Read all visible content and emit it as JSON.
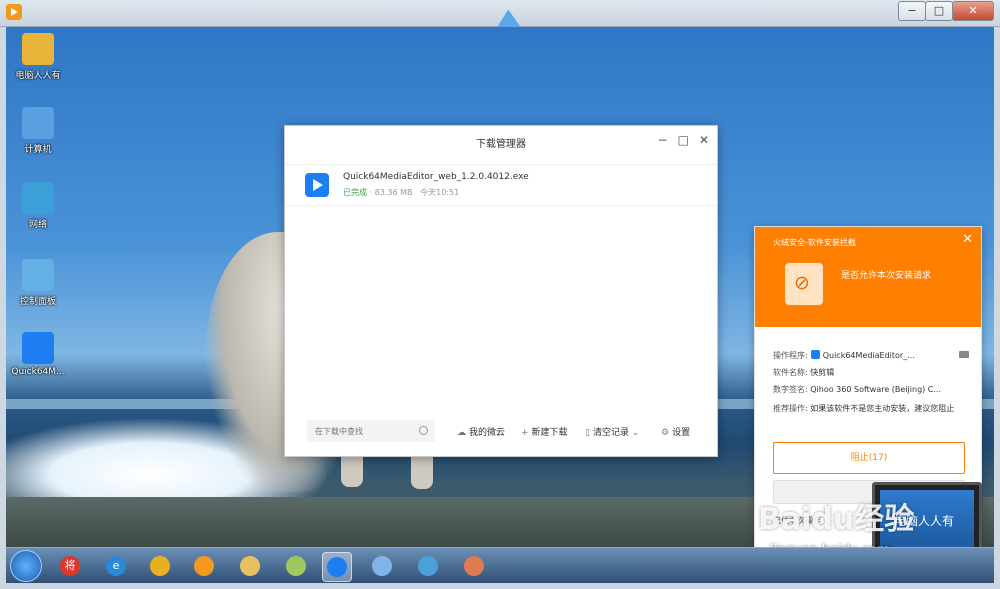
{
  "desktop_icons": [
    {
      "label": "电脑人人有",
      "icon": "folder-user-icon",
      "color": "#e8b53a"
    },
    {
      "label": "计算机",
      "icon": "computer-icon",
      "color": "#5aa0e0"
    },
    {
      "label": "网络",
      "icon": "network-icon",
      "color": "#3d9fd8"
    },
    {
      "label": "控制面板",
      "icon": "control-panel-icon",
      "color": "#63b0e6"
    },
    {
      "label": "Quick64M...",
      "icon": "quick-editor-icon",
      "color": "#1c7ef1"
    }
  ],
  "download_manager": {
    "title": "下载管理器",
    "controls": {
      "minimize": "−",
      "maximize": "□",
      "close": "✕"
    },
    "items": [
      {
        "filename": "Quick64MediaEditor_web_1.2.0.4012.exe",
        "status": "已完成",
        "size": "83.36 MB",
        "time": "今天10:51"
      }
    ],
    "footer": {
      "search_placeholder": "在下载中查找",
      "cloud": "我的微云",
      "new_download": "新建下载",
      "clear": "清空记录",
      "settings": "设置"
    }
  },
  "security_popup": {
    "title": "火绒安全-软件安装拦截",
    "close": "✕",
    "question": "是否允许本次安装请求",
    "rows": [
      {
        "key": "操作程序:",
        "value": "Quick64MediaEditor_..."
      },
      {
        "key": "软件名称:",
        "value": "快剪辑"
      },
      {
        "key": "数字签名:",
        "value": "Qihoo 360 Software (Beijing) C..."
      },
      {
        "key": "推荐操作:",
        "value": "如果该软件不是您主动安装，建议您阻止"
      }
    ],
    "block_button": "阻止(17)",
    "more": "记住本次操作"
  },
  "watermark": {
    "brand": "Baidu经验",
    "url": "jingyan.baidu.com",
    "laptop_text": "电脑人人有"
  },
  "taskbar": {
    "apps": [
      {
        "name": "taskbar-app-jiang",
        "color": "#e0352b",
        "glyph": "将"
      },
      {
        "name": "taskbar-app-ie",
        "color": "#2a8ad8",
        "glyph": "e"
      },
      {
        "name": "taskbar-app-chrome",
        "color": "#e8b020",
        "glyph": ""
      },
      {
        "name": "taskbar-app-player",
        "color": "#f39a1e",
        "glyph": ""
      },
      {
        "name": "taskbar-app-explorer",
        "color": "#e8c060",
        "glyph": ""
      },
      {
        "name": "taskbar-app-folder",
        "color": "#9fc860",
        "glyph": ""
      },
      {
        "name": "taskbar-app-quick",
        "color": "#1c7ef1",
        "glyph": "",
        "active": true
      },
      {
        "name": "taskbar-app-tool",
        "color": "#7fb4e8",
        "glyph": ""
      },
      {
        "name": "taskbar-app-panel",
        "color": "#4aa0d8",
        "glyph": ""
      },
      {
        "name": "taskbar-app-paint",
        "color": "#e07a50",
        "glyph": ""
      }
    ]
  }
}
